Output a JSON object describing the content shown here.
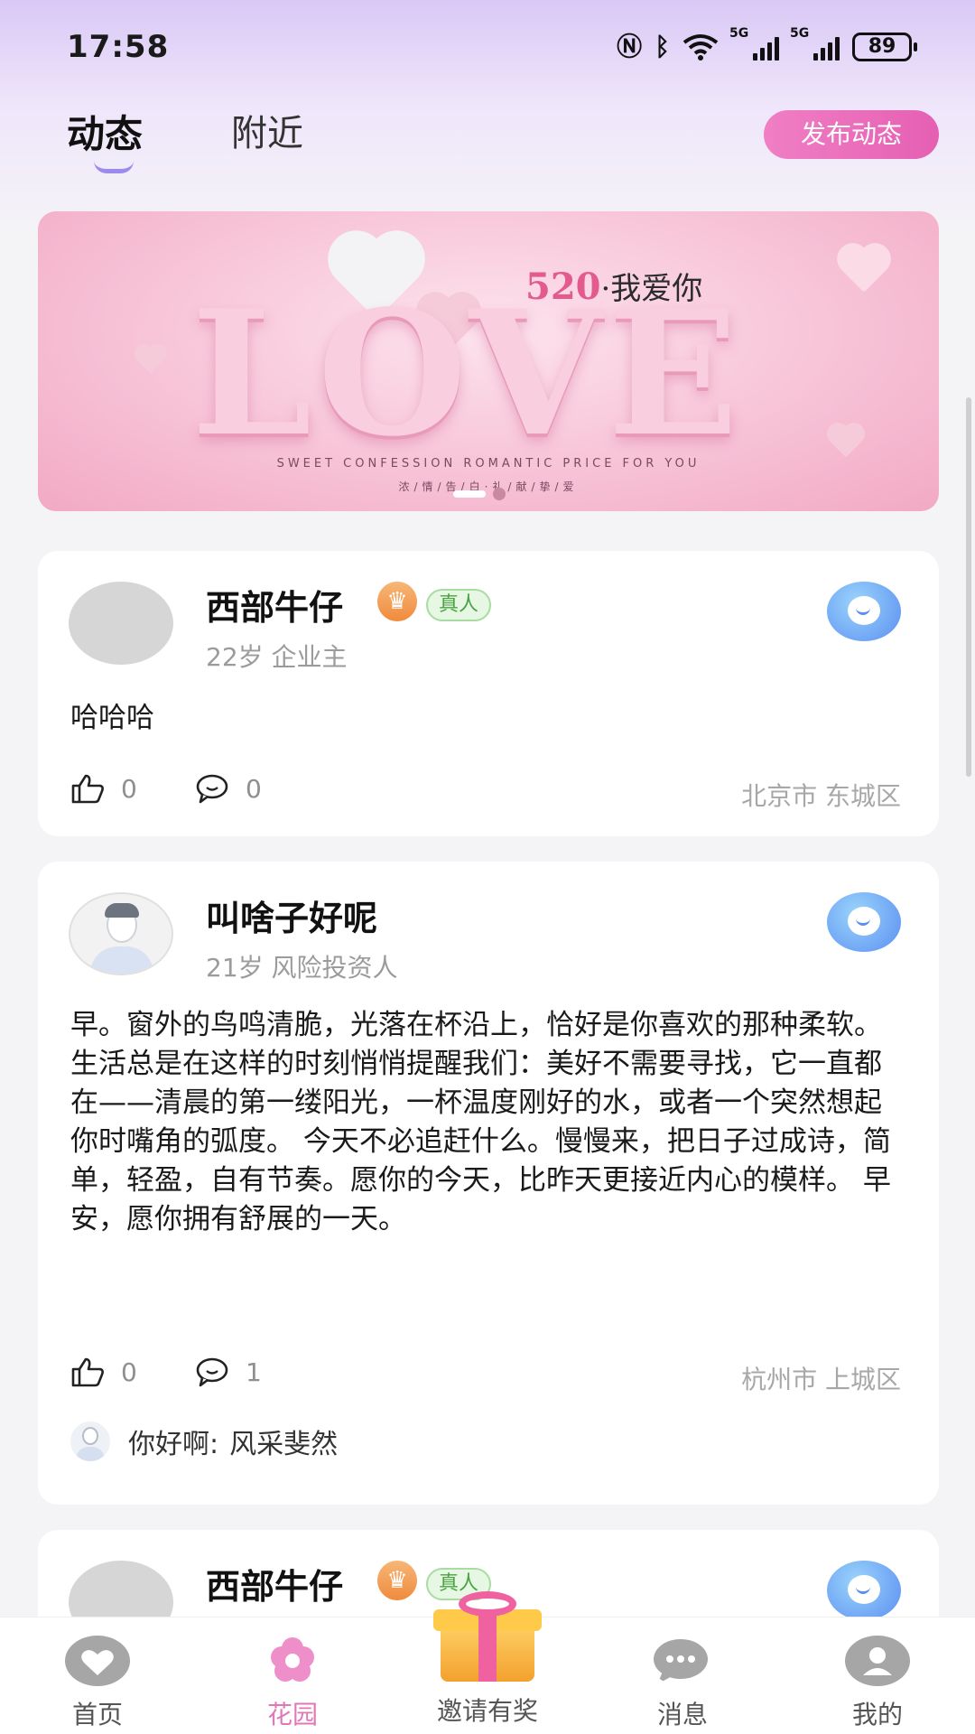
{
  "status_bar": {
    "time": "17:58",
    "battery": "89",
    "signal_1": "5G",
    "signal_2": "5G"
  },
  "tabs": {
    "feed": "动态",
    "nearby": "附近",
    "publish": "发布动态"
  },
  "banner": {
    "love": "LOVE",
    "title_num": "520",
    "title_text": "·我爱你",
    "subtitle": "SWEET CONFESSION ROMANTIC PRICE FOR YOU",
    "subtitle_cn": "浓/情/告/白·礼/献/挚/爱"
  },
  "posts": [
    {
      "name": "西部牛仔",
      "verified": "真人",
      "meta": "22岁  企业主",
      "content": "哈哈哈",
      "likes": "0",
      "comments": "0",
      "location": "北京市 东城区"
    },
    {
      "name": "叫啥子好呢",
      "meta": "21岁  风险投资人",
      "content": "早。窗外的鸟鸣清脆，光落在杯沿上，恰好是你喜欢的那种柔软。 生活总是在这样的时刻悄悄提醒我们：美好不需要寻找，它一直都在——清晨的第一缕阳光，一杯温度刚好的水，或者一个突然想起你时嘴角的弧度。 今天不必追赶什么。慢慢来，把日子过成诗，简单，轻盈，自有节奏。愿你的今天，比昨天更接近内心的模样。 早安，愿你拥有舒展的一天。",
      "likes": "0",
      "comments": "1",
      "location": "杭州市 上城区",
      "comment_author": "你好啊:",
      "comment_text": "风采斐然"
    },
    {
      "name": "西部牛仔",
      "verified": "真人"
    }
  ],
  "bottom_nav": {
    "home": "首页",
    "garden": "花园",
    "invite": "邀请有奖",
    "messages": "消息",
    "mine": "我的"
  },
  "colors": {
    "accent_pink": "#e078b8",
    "publish_gradient": "#f07fc4",
    "verified_green": "#4aa341",
    "chat_blue": "#5b8ef1"
  },
  "icons": [
    "nfc-icon",
    "bluetooth-icon",
    "wifi-icon",
    "like-icon",
    "comment-icon",
    "chat-bubble-icon",
    "crown-icon",
    "heart-icon",
    "flower-icon",
    "gift-icon",
    "message-icon",
    "user-icon"
  ]
}
